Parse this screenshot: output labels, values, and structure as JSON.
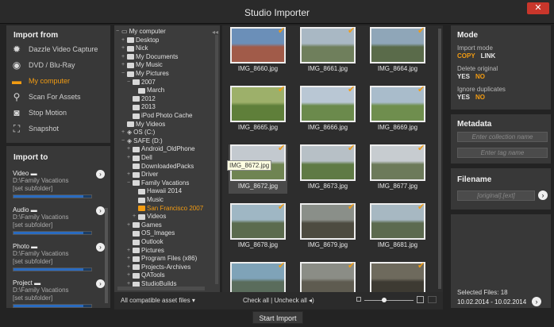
{
  "window": {
    "title": "Studio Importer",
    "close": "✕"
  },
  "import_from": {
    "heading": "Import from",
    "items": [
      {
        "label": "Dazzle Video Capture",
        "icon": "gear-icon"
      },
      {
        "label": "DVD / Blu-Ray",
        "icon": "disc-icon"
      },
      {
        "label": "My computer",
        "icon": "folder-icon",
        "active": true
      },
      {
        "label": "Scan For Assets",
        "icon": "search-icon"
      },
      {
        "label": "Stop Motion",
        "icon": "webcam-icon"
      },
      {
        "label": "Snapshot",
        "icon": "snapshot-icon"
      }
    ]
  },
  "import_to": {
    "heading": "Import to",
    "items": [
      {
        "title": "Video",
        "path": "D:\\Family Vacations",
        "sub": "[set subfolder]",
        "usage": 0.9
      },
      {
        "title": "Audio",
        "path": "D:\\Family Vacations",
        "sub": "[set subfolder]",
        "usage": 0.9
      },
      {
        "title": "Photo",
        "path": "D:\\Family Vacations",
        "sub": "[set subfolder]",
        "usage": 0.9
      },
      {
        "title": "Project",
        "path": "D:\\Family Vacations",
        "sub": "[set subfolder]",
        "usage": 0.9
      }
    ]
  },
  "tree": [
    {
      "label": "My computer",
      "depth": 0,
      "toggle": "−",
      "type": "computer"
    },
    {
      "label": "Desktop",
      "depth": 1,
      "toggle": "+"
    },
    {
      "label": "Nick",
      "depth": 1,
      "toggle": "+"
    },
    {
      "label": "My Documents",
      "depth": 1,
      "toggle": "+"
    },
    {
      "label": "My Music",
      "depth": 1,
      "toggle": "+"
    },
    {
      "label": "My Pictures",
      "depth": 1,
      "toggle": "−"
    },
    {
      "label": "2007",
      "depth": 2,
      "toggle": "−"
    },
    {
      "label": "March",
      "depth": 3,
      "toggle": ""
    },
    {
      "label": "2012",
      "depth": 2,
      "toggle": ""
    },
    {
      "label": "2013",
      "depth": 2,
      "toggle": ""
    },
    {
      "label": "iPod Photo Cache",
      "depth": 2,
      "toggle": ""
    },
    {
      "label": "My Videos",
      "depth": 1,
      "toggle": ""
    },
    {
      "label": "OS (C:)",
      "depth": 1,
      "toggle": "+",
      "type": "drive"
    },
    {
      "label": "SAFE (D:)",
      "depth": 1,
      "toggle": "−",
      "type": "drive"
    },
    {
      "label": "Android_OldPhone",
      "depth": 2,
      "toggle": "+"
    },
    {
      "label": "Dell",
      "depth": 2,
      "toggle": "+"
    },
    {
      "label": "DownloadedPacks",
      "depth": 2,
      "toggle": ""
    },
    {
      "label": "Driver",
      "depth": 2,
      "toggle": "+"
    },
    {
      "label": "Family Vacations",
      "depth": 2,
      "toggle": "−"
    },
    {
      "label": "Hawaii 2014",
      "depth": 3,
      "toggle": ""
    },
    {
      "label": "Music",
      "depth": 3,
      "toggle": ""
    },
    {
      "label": "San Francisco 2007",
      "depth": 3,
      "toggle": "",
      "selected": true
    },
    {
      "label": "Videos",
      "depth": 3,
      "toggle": "+"
    },
    {
      "label": "Games",
      "depth": 2,
      "toggle": "+"
    },
    {
      "label": "OS_Images",
      "depth": 2,
      "toggle": ""
    },
    {
      "label": "Outlook",
      "depth": 2,
      "toggle": ""
    },
    {
      "label": "Pictures",
      "depth": 2,
      "toggle": "+"
    },
    {
      "label": "Program Files (x86)",
      "depth": 2,
      "toggle": "+"
    },
    {
      "label": "Projects-Archives",
      "depth": 2,
      "toggle": "+"
    },
    {
      "label": "QATools",
      "depth": 2,
      "toggle": "+"
    },
    {
      "label": "StudioBuilds",
      "depth": 2,
      "toggle": "+"
    }
  ],
  "thumbnails": [
    {
      "name": "IMG_8660.jpg",
      "c1": "#6b8fb8",
      "c2": "#a15b49"
    },
    {
      "name": "IMG_8661.jpg",
      "c1": "#a9b8c4",
      "c2": "#6f7f5c"
    },
    {
      "name": "IMG_8664.jpg",
      "c1": "#8fa6b8",
      "c2": "#5a6b4a"
    },
    {
      "name": "IMG_8665.jpg",
      "c1": "#9db06a",
      "c2": "#5f7f3a"
    },
    {
      "name": "IMG_8666.jpg",
      "c1": "#b9c7d4",
      "c2": "#6b8a4c"
    },
    {
      "name": "IMG_8669.jpg",
      "c1": "#a9bccb",
      "c2": "#6f8e4e"
    },
    {
      "name": "IMG_8672.jpg",
      "c1": "#c3c9cf",
      "c2": "#6f8452",
      "highlight": true
    },
    {
      "name": "IMG_8673.jpg",
      "c1": "#b7c0c6",
      "c2": "#5f7a45"
    },
    {
      "name": "IMG_8677.jpg",
      "c1": "#c7ccd0",
      "c2": "#6c7a5a"
    },
    {
      "name": "IMG_8678.jpg",
      "c1": "#9fb7c4",
      "c2": "#5b6b4e"
    },
    {
      "name": "IMG_8679.jpg",
      "c1": "#8a8f89",
      "c2": "#4d4b40"
    },
    {
      "name": "IMG_8681.jpg",
      "c1": "#a7b8c2",
      "c2": "#5c6a4f"
    },
    {
      "name": "",
      "c1": "#7fa3b8",
      "c2": "#5a6c5c"
    },
    {
      "name": "",
      "c1": "#8b8d86",
      "c2": "#5e5b50"
    },
    {
      "name": "",
      "c1": "#6e6a5d",
      "c2": "#3d3a32"
    }
  ],
  "tooltip": "IMG_8672.jpg",
  "bottom_bar": {
    "filter": "All compatible asset files",
    "check_all": "Check all",
    "separator": "|",
    "uncheck_all": "Uncheck all",
    "zoom_level": 0.4
  },
  "mode": {
    "heading": "Mode",
    "import_mode_label": "Import mode",
    "import_mode": {
      "on": "COPY",
      "off": "LINK"
    },
    "delete_label": "Delete original",
    "delete": {
      "on": "NO",
      "off": "YES"
    },
    "dup_label": "Ignore duplicates",
    "dup": {
      "on": "NO",
      "off": "YES"
    }
  },
  "metadata": {
    "heading": "Metadata",
    "collection_placeholder": "Enter collection name",
    "tag_placeholder": "Enter tag name"
  },
  "filename": {
    "heading": "Filename",
    "value": "[original].[ext]"
  },
  "selection": {
    "label": "Selected Files: 18",
    "range": "10.02.2014 - 10.02.2014"
  },
  "start_label": "Start Import"
}
